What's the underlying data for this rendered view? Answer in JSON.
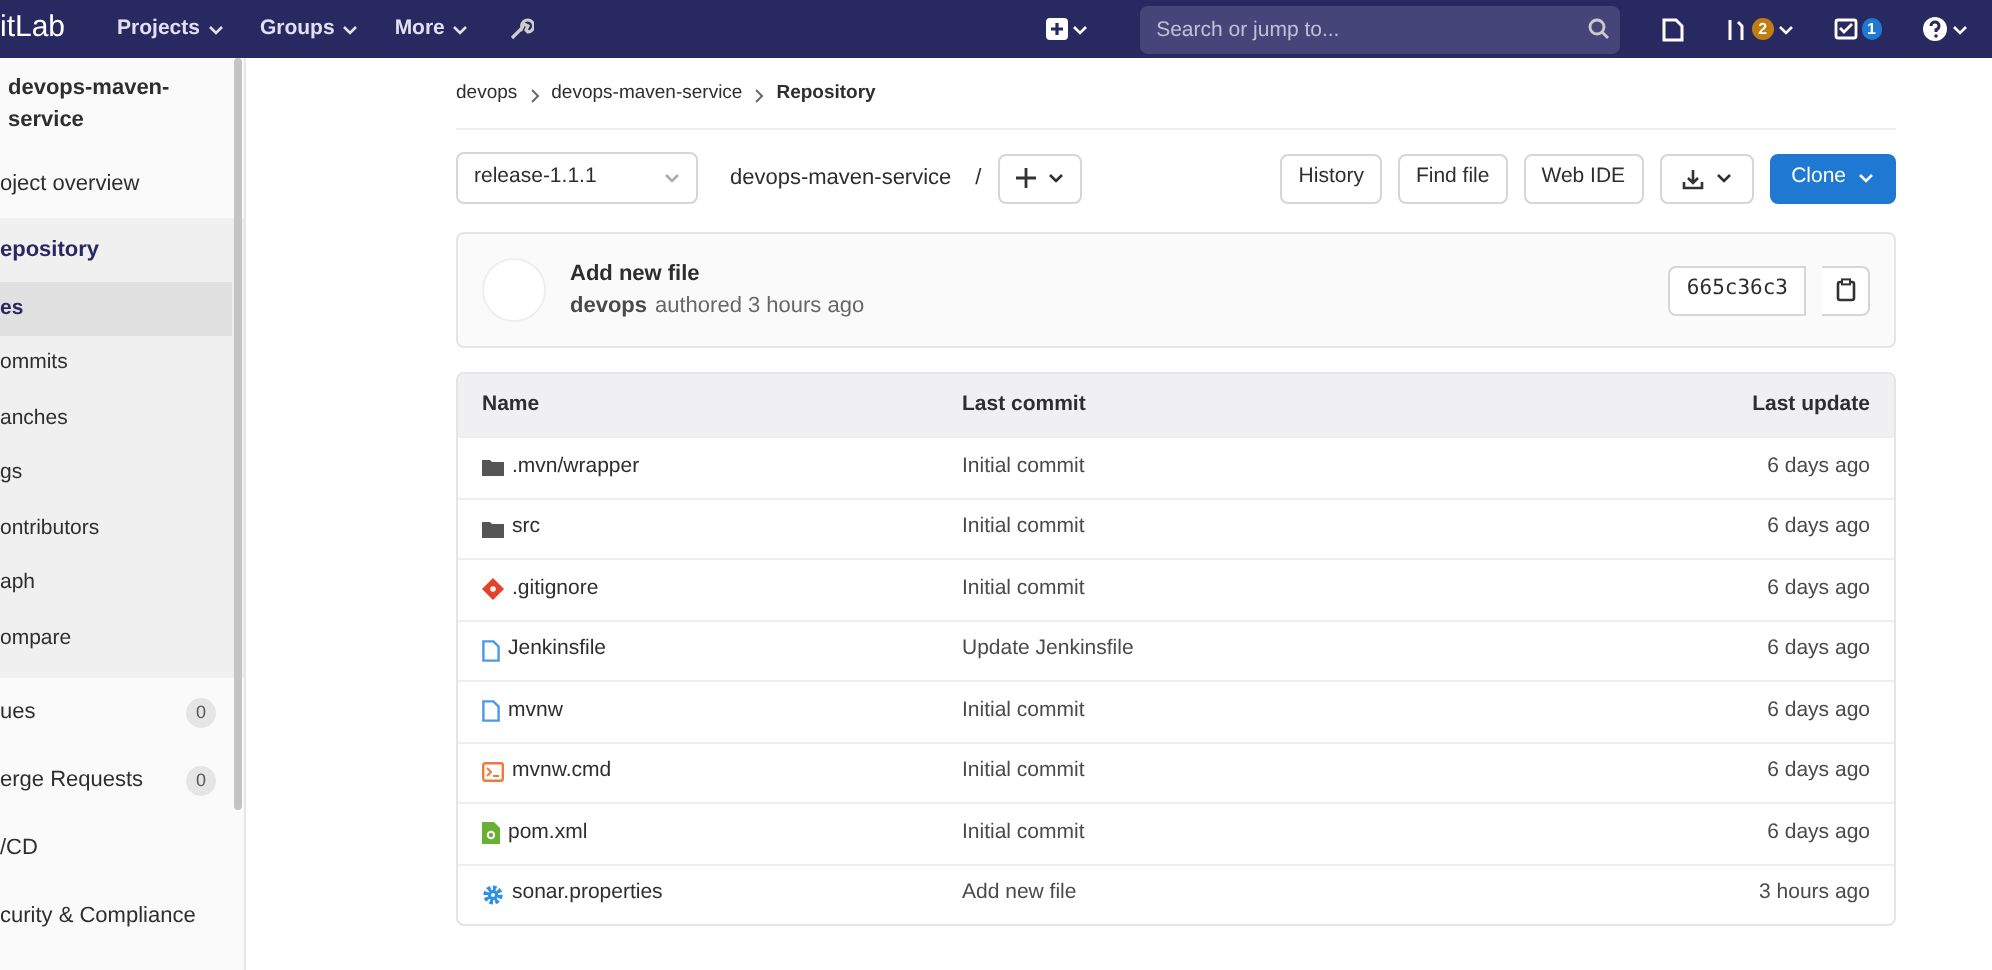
{
  "top_nav": {
    "logo": "itLab",
    "menus": [
      {
        "label": "Projects"
      },
      {
        "label": "Groups"
      },
      {
        "label": "More"
      }
    ],
    "search": {
      "placeholder": "Search or jump to..."
    },
    "merge_requests_count": "2",
    "todos_count": "1"
  },
  "sidebar": {
    "project_name": "devops-maven- service",
    "items": [
      {
        "label": "oject overview",
        "selected": false
      },
      {
        "label": "epository",
        "selected": false,
        "expanded": true,
        "children": [
          {
            "label": "es",
            "selected": true
          },
          {
            "label": "ommits",
            "selected": false
          },
          {
            "label": "anches",
            "selected": false
          },
          {
            "label": "gs",
            "selected": false
          },
          {
            "label": "ontributors",
            "selected": false
          },
          {
            "label": "aph",
            "selected": false
          },
          {
            "label": "ompare",
            "selected": false
          }
        ]
      },
      {
        "label": "ues",
        "selected": false,
        "count": "0"
      },
      {
        "label": "erge Requests",
        "selected": false,
        "count": "0"
      },
      {
        "label": "/CD",
        "selected": false
      },
      {
        "label": "curity & Compliance",
        "selected": false
      }
    ]
  },
  "breadcrumbs": [
    "devops",
    "devops-maven-service",
    "Repository"
  ],
  "toolbar": {
    "branch": "release-1.1.1",
    "path": "devops-maven-service",
    "separator": "/",
    "buttons": [
      "History",
      "Find file",
      "Web IDE"
    ],
    "clone": "Clone"
  },
  "last_commit": {
    "title": "Add new file",
    "author": "devops",
    "meta": "authored 3 hours ago",
    "sha": "665c36c3"
  },
  "table": {
    "columns": [
      "Name",
      "Last commit",
      "Last update"
    ],
    "rows": [
      {
        "kind": "folder",
        "name": ".mvn/wrapper",
        "commit": "Initial commit",
        "updated": "6 days ago"
      },
      {
        "kind": "folder",
        "name": "src",
        "commit": "Initial commit",
        "updated": "6 days ago"
      },
      {
        "kind": "git",
        "name": ".gitignore",
        "commit": "Initial commit",
        "updated": "6 days ago"
      },
      {
        "kind": "file",
        "name": "Jenkinsfile",
        "commit": "Update Jenkinsfile",
        "updated": "6 days ago"
      },
      {
        "kind": "file",
        "name": "mvnw",
        "commit": "Initial commit",
        "updated": "6 days ago"
      },
      {
        "kind": "terminal",
        "name": "mvnw.cmd",
        "commit": "Initial commit",
        "updated": "6 days ago"
      },
      {
        "kind": "xml",
        "name": "pom.xml",
        "commit": "Initial commit",
        "updated": "6 days ago"
      },
      {
        "kind": "gear",
        "name": "sonar.properties",
        "commit": "Add new file",
        "updated": "3 hours ago"
      }
    ]
  }
}
